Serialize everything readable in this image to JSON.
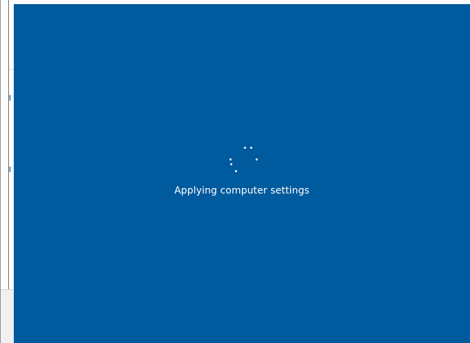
{
  "overlay": {
    "status_text": "Applying computer settings",
    "background_color": "#005a9e",
    "text_color": "#ffffff"
  },
  "spinner": {
    "icon": "loading-spinner-icon",
    "dot_count": 5
  }
}
